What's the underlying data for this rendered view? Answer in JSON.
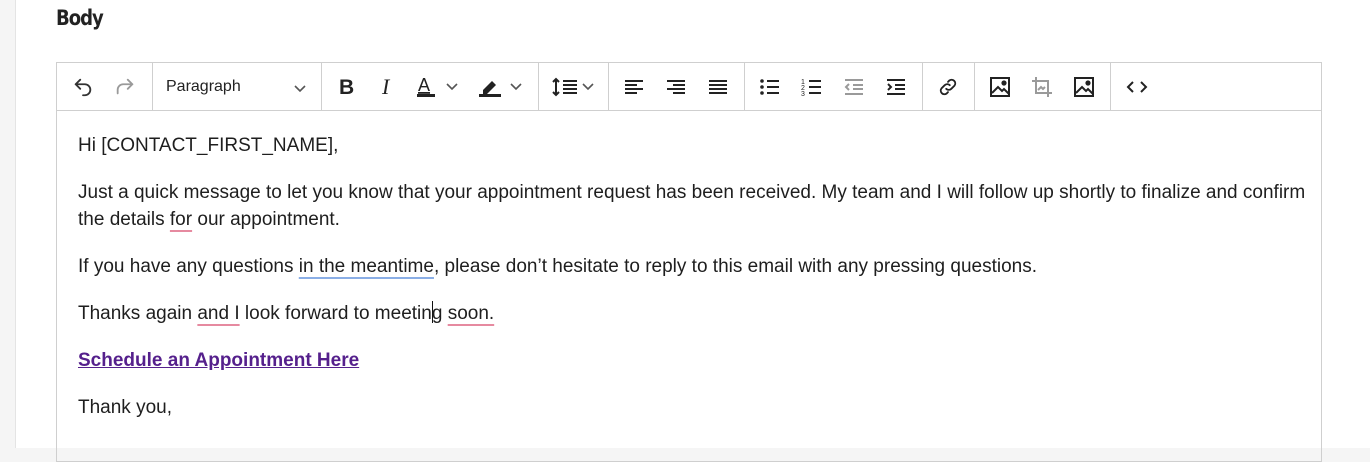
{
  "section": {
    "label": "Body"
  },
  "toolbar": {
    "block_format": "Paragraph",
    "icons": [
      "undo-icon",
      "redo-icon",
      "chevron-down-icon",
      "bold-icon",
      "italic-icon",
      "text-color-icon",
      "highlight-icon",
      "line-height-icon",
      "align-left-icon",
      "align-right-icon",
      "justify-icon",
      "bullet-list-icon",
      "numbered-list-icon",
      "outdent-icon",
      "indent-icon",
      "link-icon",
      "image-icon",
      "crop-image-icon",
      "image-edit-icon",
      "source-code-icon"
    ],
    "text_color": "#222222"
  },
  "content": {
    "greeting": "Hi [CONTACT_FIRST_NAME],",
    "para1_a": "Just a quick message to let you know that your appointment request has been received. My team and I will follow up shortly to finalize and confirm the details ",
    "para1_b": "for",
    "para1_c": " our appointment.",
    "para2_a": "If you have any questions ",
    "para2_b": "in the meantime",
    "para2_c": ", please don’t hesitate to reply to this email with any pressing questions.",
    "para3_a": "Thanks again ",
    "para3_b": "and I",
    "para3_c": " look forward to meetin",
    "para3_d": "g ",
    "para3_e": "soon.",
    "link_text": "Schedule an Appointment Here",
    "closing": "Thank you,"
  },
  "colors": {
    "link": "#55208c",
    "spell_error_underline": "#e68aa0",
    "grammar_underline": "#8aaee6"
  }
}
